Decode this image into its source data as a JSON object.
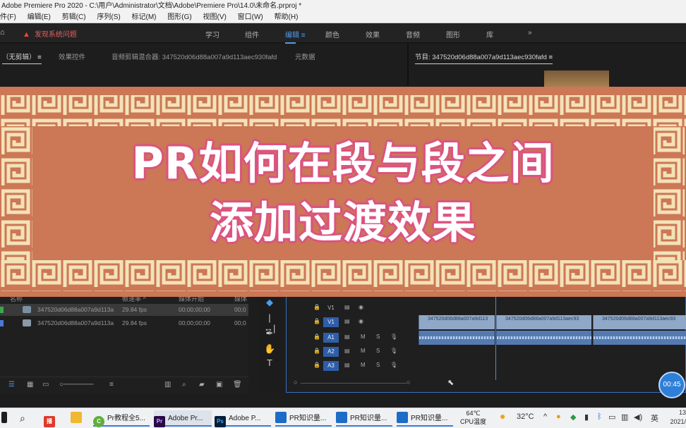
{
  "window": {
    "title": "Adobe Premiere Pro 2020 - C:\\用户\\Administrator\\文档\\Adobe\\Premiere Pro\\14.0\\未命名.prproj *"
  },
  "menu": [
    "件(F)",
    "编辑(E)",
    "剪辑(C)",
    "序列(S)",
    "标记(M)",
    "图形(G)",
    "视图(V)",
    "窗口(W)",
    "帮助(H)"
  ],
  "workspace": {
    "alert": "发现系统问题",
    "tabs": [
      "学习",
      "组件",
      "编辑",
      "颜色",
      "效果",
      "音频",
      "图形",
      "库"
    ],
    "active_tab": "编辑",
    "more": "»"
  },
  "panels": {
    "source_tab": "（无剪辑）",
    "effect_controls_tab": "效果控件",
    "audio_mixer_tab": "音频剪辑混合器: 347520d06d88a007a9d113aec930fafd",
    "metadata_tab": "元数据",
    "program_tab": "节目: 347520d06d88a007a9d113aec930fafd"
  },
  "banner": {
    "line1": "PR如何在段与段之间",
    "line2": "添加过渡效果",
    "background": "#cc7755"
  },
  "project": {
    "headers": [
      "名称",
      "帧速率 ^",
      "媒体开始",
      "媒体"
    ],
    "rows": [
      {
        "name": "347520d06d88a007a9d113a",
        "fps": "29.84 fps",
        "start": "00;00;00;00",
        "end": "00;0",
        "color": "#3aa84a"
      },
      {
        "name": "347520d06d88a007a9d113a",
        "fps": "29.84 fps",
        "start": "00;00;00;00",
        "end": "00;0",
        "color": "#4a78d8"
      }
    ]
  },
  "timeline": {
    "tracks": [
      {
        "name": "V1",
        "kind": "video",
        "highlight": false
      },
      {
        "name": "V1",
        "kind": "video",
        "highlight": true
      },
      {
        "name": "A1",
        "kind": "audio",
        "highlight": true
      },
      {
        "name": "A2",
        "kind": "audio",
        "highlight": true
      },
      {
        "name": "A3",
        "kind": "audio",
        "highlight": true
      }
    ],
    "track_buttons": {
      "mute": "M",
      "solo": "S"
    },
    "clip_labels": [
      "347520d06d88a007a9d113",
      "347520d06d88a007a9d113aec93",
      "347520d06d88a007a9d113aec93"
    ]
  },
  "timer": "00:45",
  "taskbar": {
    "items": [
      {
        "label": "",
        "icon": "search-icon"
      },
      {
        "label": "",
        "icon": "app-red"
      },
      {
        "label": "",
        "icon": "folder"
      },
      {
        "label": "Pr教程全5...",
        "icon": "browser"
      },
      {
        "label": "Adobe Pr...",
        "icon": "Pr"
      },
      {
        "label": "Adobe P...",
        "icon": "Ps"
      },
      {
        "label": "PR知识量...",
        "icon": "img"
      },
      {
        "label": "PR知识量...",
        "icon": "img"
      },
      {
        "label": "PR知识量...",
        "icon": "img"
      }
    ],
    "cpu_temp": "64℃",
    "cpu_label": "CPU温度",
    "weather": "32°C",
    "lang": "英",
    "clock_time": "13",
    "clock_date": "2021/"
  }
}
